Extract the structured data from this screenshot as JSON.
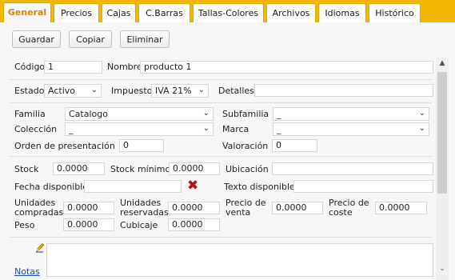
{
  "tabs": [
    "General",
    "Precios",
    "Cajas",
    "C.Barras",
    "Tallas-Colores",
    "Archivos",
    "Idiomas",
    "Histórico"
  ],
  "actions": {
    "save": "Guardar",
    "copy": "Copiar",
    "delete": "Eliminar"
  },
  "fields": {
    "codigo": {
      "label": "Código",
      "value": "1"
    },
    "nombre": {
      "label": "Nombre",
      "value": "producto 1"
    },
    "estado": {
      "label": "Estado",
      "value": "Activo"
    },
    "impuesto": {
      "label": "Impuesto",
      "value": "IVA 21%"
    },
    "detalles": {
      "label": "Detalles",
      "value": ""
    },
    "familia": {
      "label": "Familia",
      "value": "Catalogo"
    },
    "subfamilia": {
      "label": "Subfamilia",
      "value": "_"
    },
    "coleccion": {
      "label": "Colección",
      "value": "_"
    },
    "marca": {
      "label": "Marca",
      "value": "_"
    },
    "orden": {
      "label": "Orden de presentación",
      "value": "0"
    },
    "valoracion": {
      "label": "Valoración",
      "value": "0"
    },
    "stock": {
      "label": "Stock",
      "value": "0.0000"
    },
    "stock_minimo": {
      "label": "Stock mínimo",
      "value": "0.0000"
    },
    "ubicacion": {
      "label": "Ubicación",
      "value": ""
    },
    "fecha_disponible": {
      "label": "Fecha disponible",
      "value": ""
    },
    "texto_disponible": {
      "label": "Texto disponible",
      "value": ""
    },
    "unidades_compradas": {
      "label1": "Unidades",
      "label2": "compradas",
      "value": "0.0000"
    },
    "unidades_reservadas": {
      "label1": "Unidades",
      "label2": "reservadas",
      "value": "0.0000"
    },
    "precio_venta": {
      "label1": "Precio de",
      "label2": "venta",
      "value": "0.0000"
    },
    "precio_coste": {
      "label1": "Precio de",
      "label2": "coste",
      "value": "0.0000"
    },
    "peso": {
      "label": "Peso",
      "value": "0.0000"
    },
    "cubicaje": {
      "label": "Cubicaje",
      "value": "0.0000"
    }
  },
  "notas": {
    "label": "Notas",
    "value": ""
  },
  "icons": {
    "clear_date": "x-icon",
    "edit": "pencil-icon",
    "dropdown": "chevron-down-icon"
  }
}
